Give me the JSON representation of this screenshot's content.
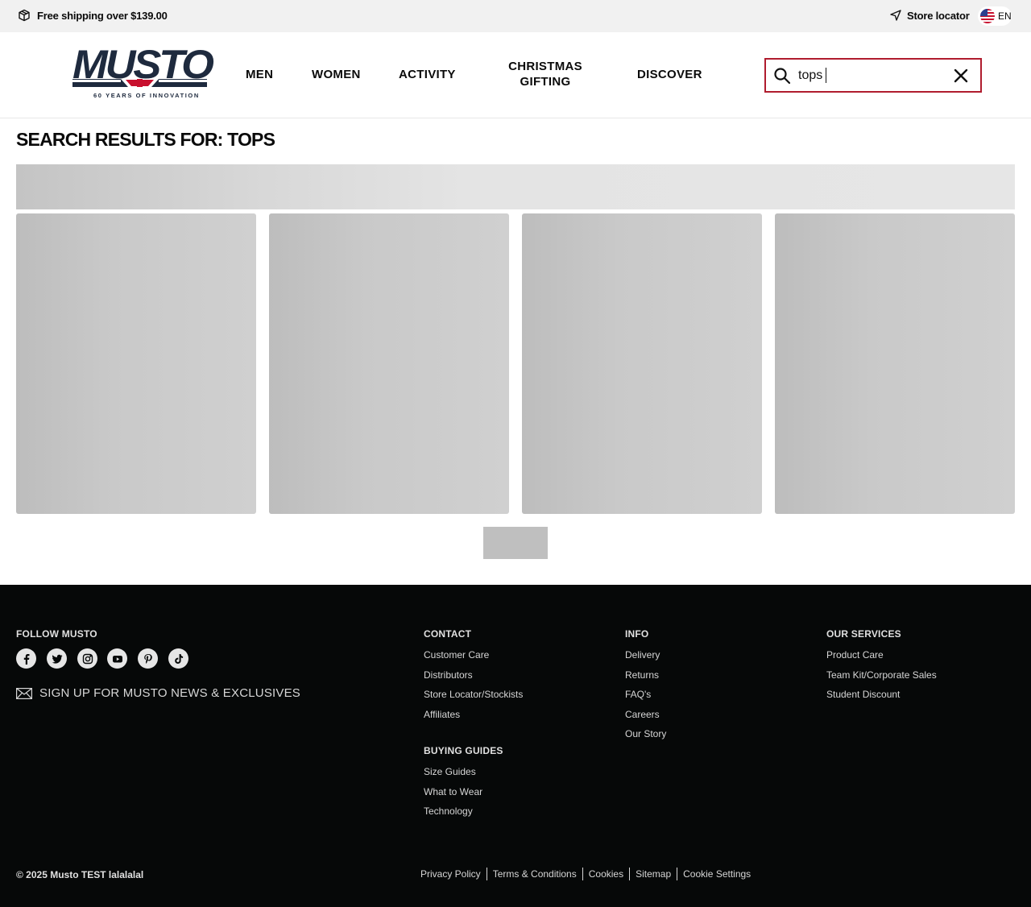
{
  "topbar": {
    "shipping_text": "Free shipping over $139.00",
    "shipping_icon": "box-icon",
    "store_locator": "Store locator",
    "store_icon": "location-arrow-icon",
    "language": "EN",
    "flag_icon": "us-flag-icon"
  },
  "header": {
    "logo_text": "MUSTO",
    "logo_tagline": "60 YEARS OF INNOVATION",
    "nav": {
      "men": "MEN",
      "women": "WOMEN",
      "activity": "ACTIVITY",
      "christmas_line1": "CHRISTMAS",
      "christmas_line2": "GIFTING",
      "discover": "DISCOVER"
    },
    "search": {
      "value": "tops",
      "icon": "search-icon",
      "clear_icon": "close-icon"
    }
  },
  "main": {
    "title": "SEARCH RESULTS FOR: TOPS"
  },
  "footer": {
    "follow_heading": "FOLLOW MUSTO",
    "social_icons": [
      "facebook-icon",
      "twitter-icon",
      "instagram-icon",
      "youtube-icon",
      "pinterest-icon",
      "tiktok-icon"
    ],
    "signup_text": "SIGN UP FOR MUSTO NEWS & EXCLUSIVES",
    "contact": {
      "heading": "CONTACT",
      "links": [
        "Customer Care",
        "Distributors",
        "Store Locator/Stockists",
        "Affiliates"
      ]
    },
    "buying_guides": {
      "heading": "BUYING GUIDES",
      "links": [
        "Size Guides",
        "What to Wear",
        "Technology"
      ]
    },
    "info": {
      "heading": "INFO",
      "links": [
        "Delivery",
        "Returns",
        "FAQ's",
        "Careers",
        "Our Story"
      ]
    },
    "services": {
      "heading": "OUR SERVICES",
      "links": [
        "Product Care",
        "Team Kit/Corporate Sales",
        "Student Discount"
      ]
    },
    "copyright": "© 2025 Musto TEST lalalalal",
    "legal": [
      "Privacy Policy",
      "Terms & Conditions",
      "Cookies",
      "Sitemap",
      "Cookie Settings"
    ]
  }
}
